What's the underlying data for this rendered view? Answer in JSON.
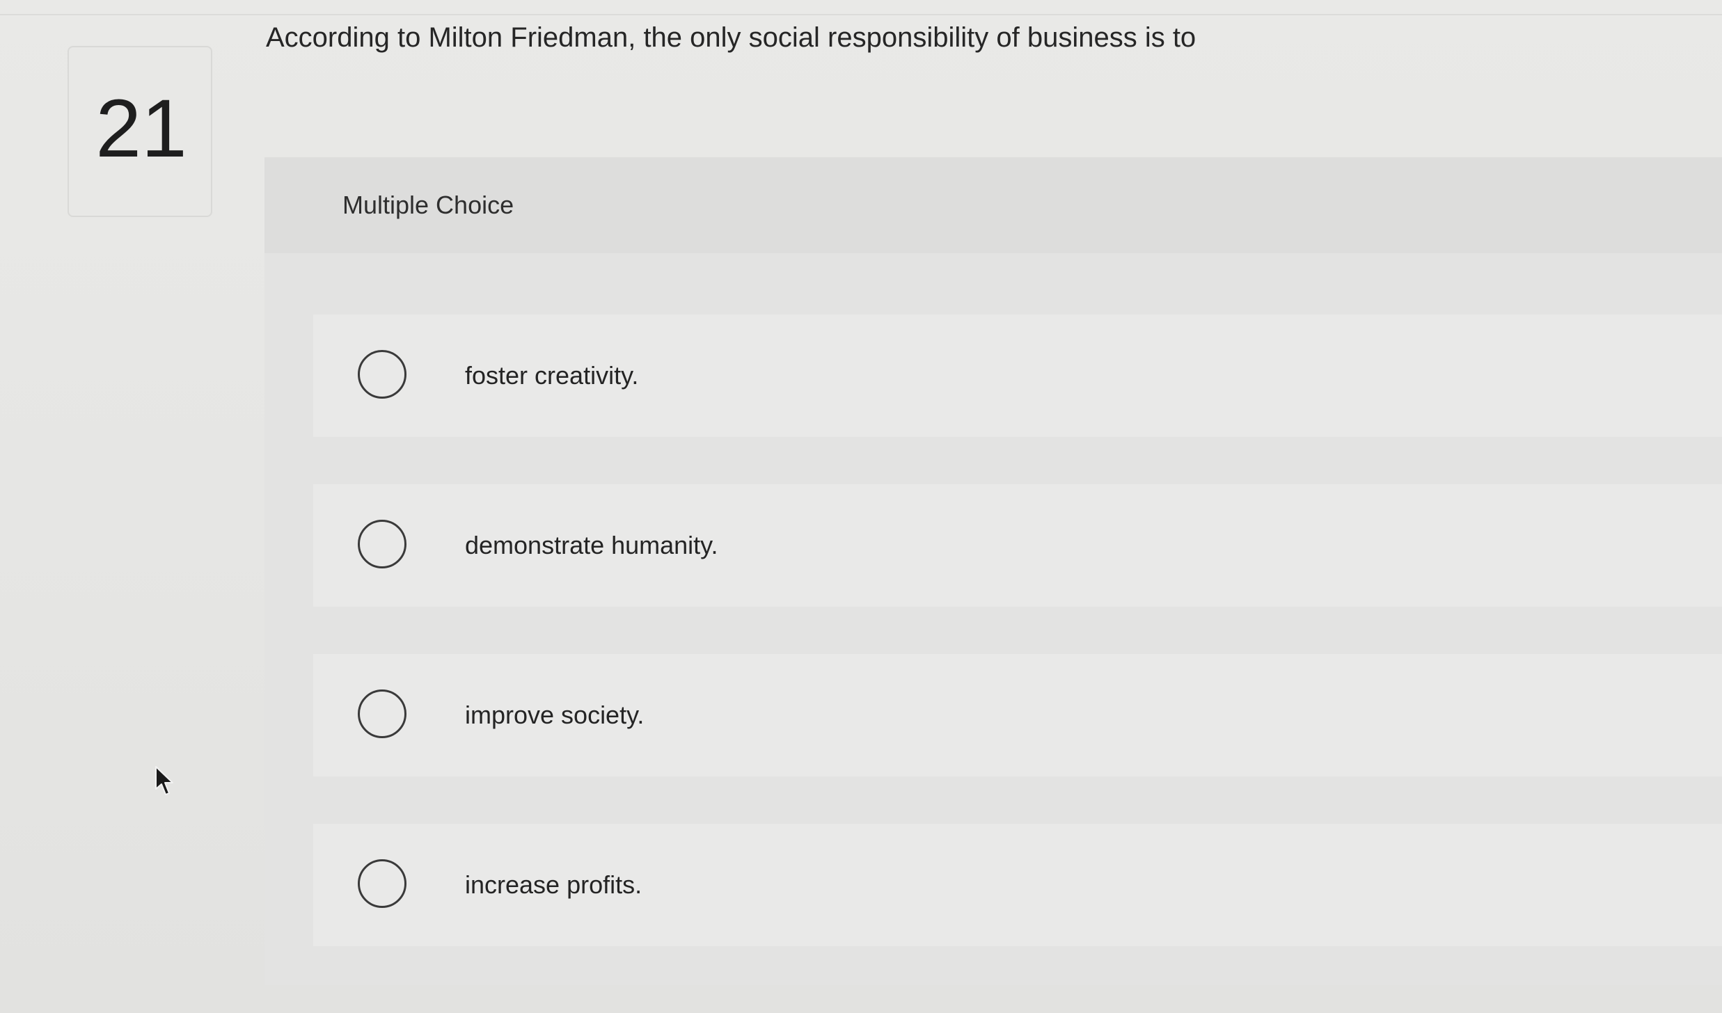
{
  "question": {
    "number": "21",
    "prompt": "According to Milton Friedman, the only social responsibility of business is to",
    "type_label": "Multiple Choice"
  },
  "options": [
    {
      "label": "foster creativity.",
      "selected": false
    },
    {
      "label": "demonstrate humanity.",
      "selected": false
    },
    {
      "label": "improve society.",
      "selected": false
    },
    {
      "label": "increase profits.",
      "selected": false
    }
  ],
  "icons": {
    "radio": "radio-unchecked-icon",
    "cursor": "mouse-pointer-icon"
  },
  "colors": {
    "background": "#e6e6e4",
    "panel": "#dedede",
    "option_row": "#e9e9e8",
    "text": "#262626",
    "radio_border": "#3a3a3a"
  }
}
